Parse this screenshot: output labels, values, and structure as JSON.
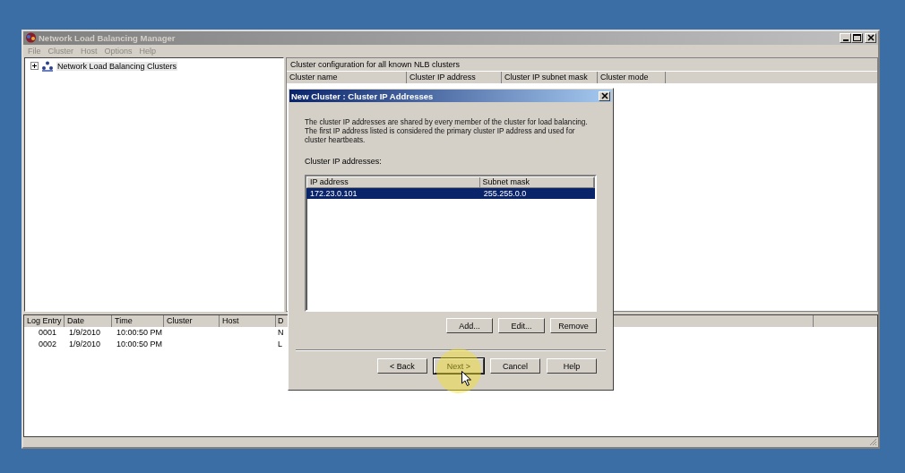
{
  "window": {
    "title": "Network Load Balancing Manager"
  },
  "menu": [
    {
      "label": "File"
    },
    {
      "label": "Cluster"
    },
    {
      "label": "Host"
    },
    {
      "label": "Options"
    },
    {
      "label": "Help"
    }
  ],
  "tree": [
    {
      "label": "Network Load Balancing Clusters",
      "expanded": false
    }
  ],
  "cluster_panel": {
    "caption": "Cluster configuration for all known NLB clusters",
    "columns": [
      "Cluster name",
      "Cluster IP address",
      "Cluster IP subnet mask",
      "Cluster mode"
    ]
  },
  "log": {
    "columns": [
      "Log Entry",
      "Date",
      "Time",
      "Cluster",
      "Host",
      "D"
    ],
    "rows": [
      [
        "0001",
        "1/9/2010",
        "10:00:50 PM",
        "",
        "",
        "N"
      ],
      [
        "0002",
        "1/9/2010",
        "10:00:50 PM",
        "",
        "",
        "L"
      ]
    ]
  },
  "dialog": {
    "title": "New Cluster : Cluster IP Addresses",
    "description": "The cluster IP addresses are shared by every member of the cluster for load balancing. The first IP address listed is considered the primary cluster IP address and used for cluster heartbeats.",
    "list_label": "Cluster IP addresses:",
    "list": {
      "columns": [
        "IP address",
        "Subnet mask"
      ],
      "rows": [
        {
          "cells": [
            "172.23.0.101",
            "255.255.0.0"
          ],
          "selected": true
        }
      ]
    },
    "list_buttons": [
      "Add...",
      "Edit...",
      "Remove"
    ],
    "nav_buttons": [
      {
        "label": "< Back",
        "default": false
      },
      {
        "label": "Next >",
        "default": true
      },
      {
        "label": "Cancel",
        "default": false
      },
      {
        "label": "Help",
        "default": false
      }
    ]
  }
}
